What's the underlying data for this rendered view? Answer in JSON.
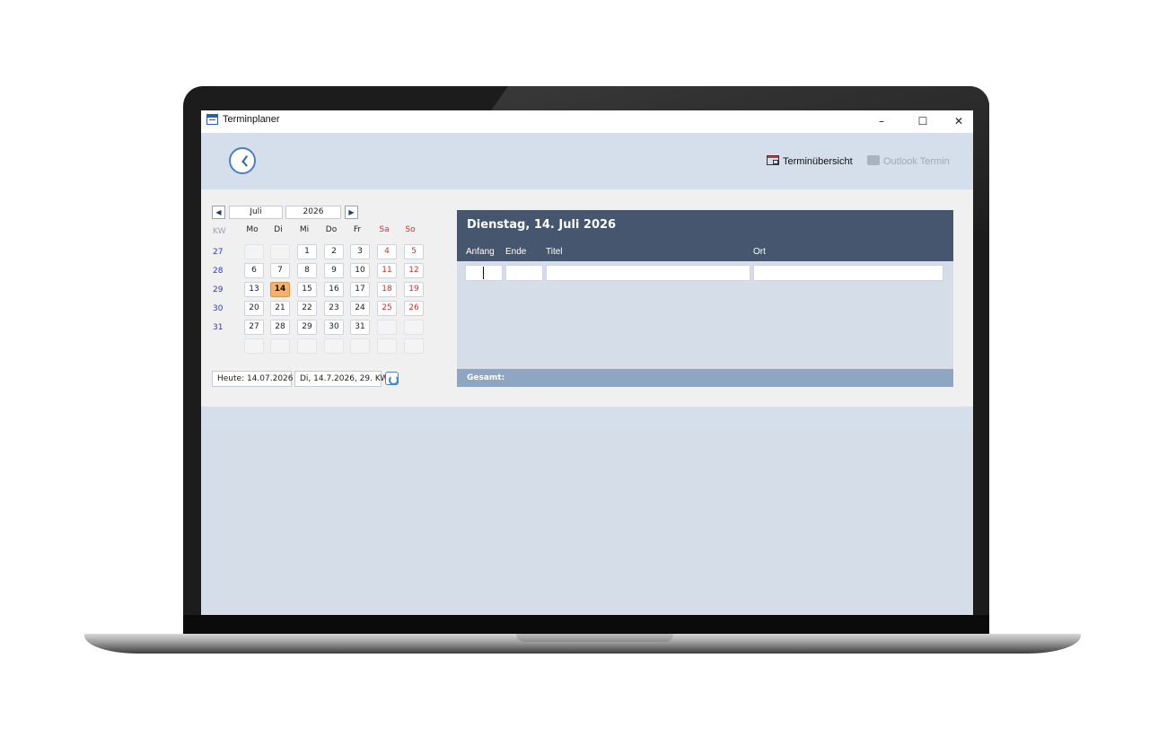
{
  "window": {
    "title": "Terminplaner",
    "controls": {
      "minimize": "–",
      "maximize": "☐",
      "close": "✕"
    }
  },
  "header": {
    "logo_icon": "clock-icon",
    "overview_link": "Terminübersicht",
    "outlook_link": "Outlook Termin",
    "outlook_link_enabled": false
  },
  "calendar": {
    "month": "Juli",
    "year": "2026",
    "kw_label": "KW",
    "weekdays": [
      "Mo",
      "Di",
      "Mi",
      "Do",
      "Fr",
      "Sa",
      "So"
    ],
    "weeks": [
      {
        "kw": "27",
        "days": [
          "",
          "",
          "1",
          "2",
          "3",
          "4",
          "5"
        ]
      },
      {
        "kw": "28",
        "days": [
          "6",
          "7",
          "8",
          "9",
          "10",
          "11",
          "12"
        ]
      },
      {
        "kw": "29",
        "days": [
          "13",
          "14",
          "15",
          "16",
          "17",
          "18",
          "19"
        ]
      },
      {
        "kw": "30",
        "days": [
          "20",
          "21",
          "22",
          "23",
          "24",
          "25",
          "26"
        ]
      },
      {
        "kw": "31",
        "days": [
          "27",
          "28",
          "29",
          "30",
          "31",
          "",
          ""
        ]
      },
      {
        "kw": "",
        "days": [
          "",
          "",
          "",
          "",
          "",
          "",
          ""
        ]
      }
    ],
    "selected_day": "14",
    "today_label": "Heute: 14.07.2026",
    "selected_label": "Di, 14.7.2026, 29. KW"
  },
  "day_view": {
    "title": "Dienstag, 14. Juli 2026",
    "columns": [
      "Anfang",
      "Ende",
      "Titel",
      "Ort"
    ],
    "entry": {
      "anfang": "",
      "ende": "",
      "titel": "",
      "ort": ""
    },
    "total_label": "Gesamt:"
  },
  "colors": {
    "accent": "#46566e",
    "today_highlight": "#f6b26b",
    "weekend": "#d03030",
    "kw_number": "#2b3bd1",
    "band": "#d4dfeb"
  }
}
